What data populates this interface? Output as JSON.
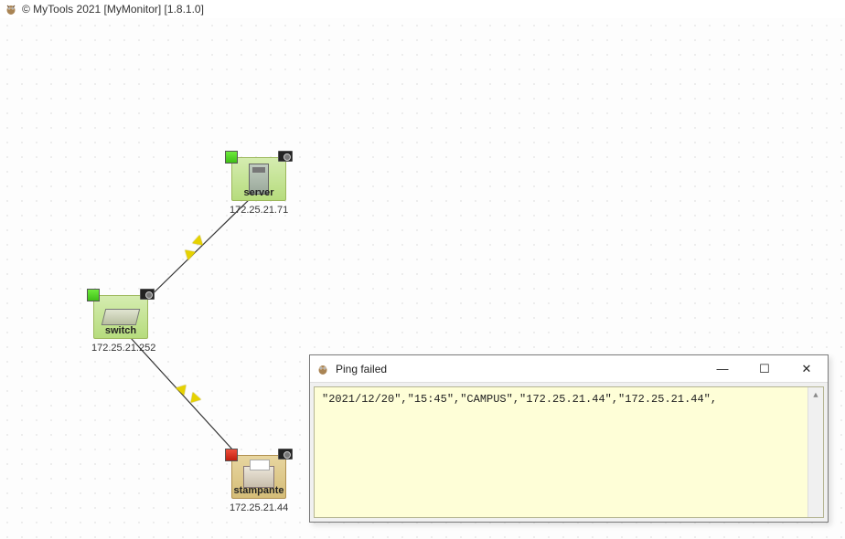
{
  "app": {
    "icon": "owl-icon",
    "title": "© MyTools 2021 [MyMonitor] [1.8.1.0]"
  },
  "nodes": {
    "server": {
      "name": "server",
      "ip": "172.25.21.71",
      "status": "green"
    },
    "switch": {
      "name": "switch",
      "ip": "172.25.21.252",
      "status": "green"
    },
    "printer": {
      "name": "stampante",
      "ip": "172.25.21.44",
      "status": "red"
    }
  },
  "popup": {
    "title": "Ping failed",
    "log_line": "\"2021/12/20\",\"15:45\",\"CAMPUS\",\"172.25.21.44\",\"172.25.21.44\","
  },
  "window_controls": {
    "minimize": "—",
    "maximize": "☐",
    "close": "✕"
  }
}
